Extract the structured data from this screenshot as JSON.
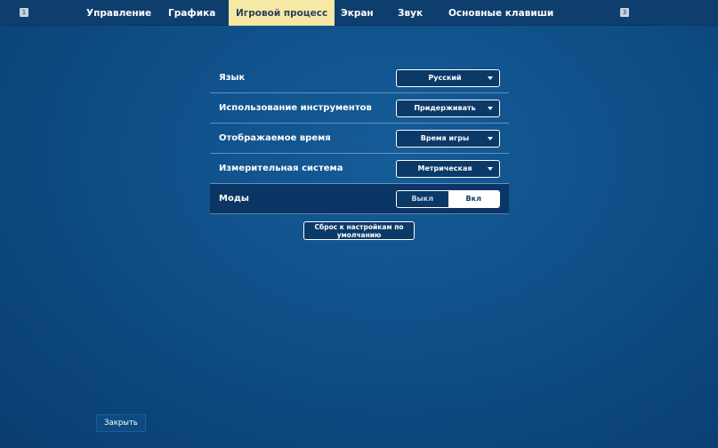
{
  "topbar": {
    "left_key": "1",
    "right_key": "3",
    "tabs": [
      {
        "label": "Управление",
        "active": false
      },
      {
        "label": "Графика",
        "active": false
      },
      {
        "label": "Игровой процесс",
        "active": true
      },
      {
        "label": "Экран",
        "active": false
      },
      {
        "label": "Звук",
        "active": false
      },
      {
        "label": "Основные клавиши",
        "active": false
      }
    ]
  },
  "settings": {
    "language": {
      "label": "Язык",
      "value": "Русский"
    },
    "tool_usage": {
      "label": "Использование инструментов",
      "value": "Придерживать"
    },
    "displayed_time": {
      "label": "Отображаемое время",
      "value": "Время игры"
    },
    "measurement": {
      "label": "Измерительная система",
      "value": "Метрическая"
    },
    "mods": {
      "label": "Моды",
      "off_label": "Выкл",
      "on_label": "Вкл",
      "selected": "Вкл"
    }
  },
  "reset_button": "Сброс к настройкам по умолчанию",
  "close_button": "Закрыть",
  "colors": {
    "background": "#0f4f88",
    "topbar": "#0d3e6d",
    "active_tab": "#f6e9a6",
    "highlight_row": "#0b3564"
  }
}
